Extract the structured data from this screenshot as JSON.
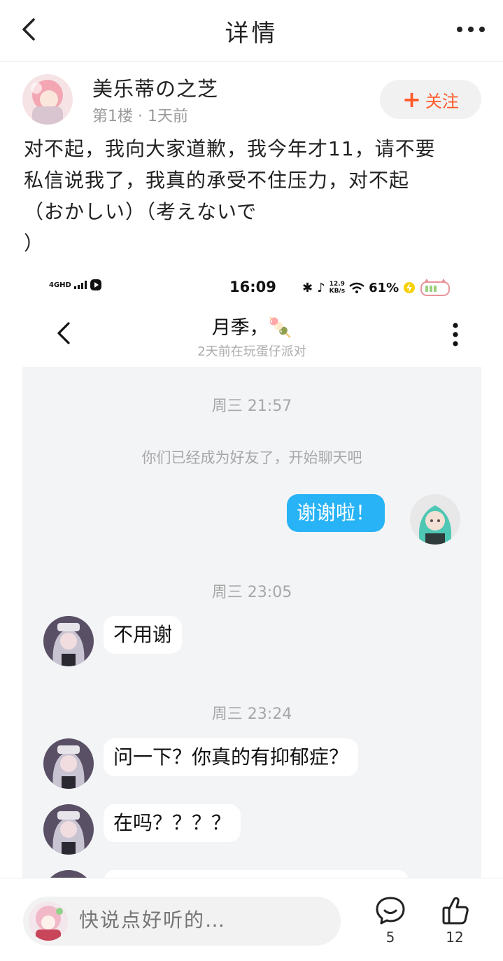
{
  "header": {
    "title": "详情"
  },
  "post": {
    "author": "美乐蒂の之芝",
    "meta": "第1楼 · 1天前",
    "follow_label": "关注",
    "lines": [
      "对不起，我向大家道歉，我今年才11，请不要",
      "私信说我了，我真的承受不住压力，对不起",
      "（おかしい）（考えないで",
      "）"
    ]
  },
  "screenshot": {
    "status": {
      "network": "4GHD",
      "time": "16:09",
      "speed_top": "12.9",
      "speed_bottom": "KB/s",
      "battery": "61%"
    },
    "chat_header": {
      "name": "月季，🍡",
      "status": "2天前在玩蛋仔派对"
    },
    "messages": {
      "ts1": "周三 21:57",
      "system": "你们已经成为好友了，开始聊天吧",
      "m1": "谢谢啦！",
      "ts2": "周三 23:05",
      "m2": "不用谢",
      "ts3": "周三 23:24",
      "m3": "问一下？你真的有抑郁症？",
      "m4": "在吗？？？？"
    }
  },
  "bottom": {
    "input_placeholder": "快说点好听的…",
    "comment_count": "5",
    "like_count": "12"
  },
  "colors": {
    "accent": "#ff5a2a",
    "bubble_out": "#27b3f5",
    "chat_bg": "#f3f4f6"
  }
}
